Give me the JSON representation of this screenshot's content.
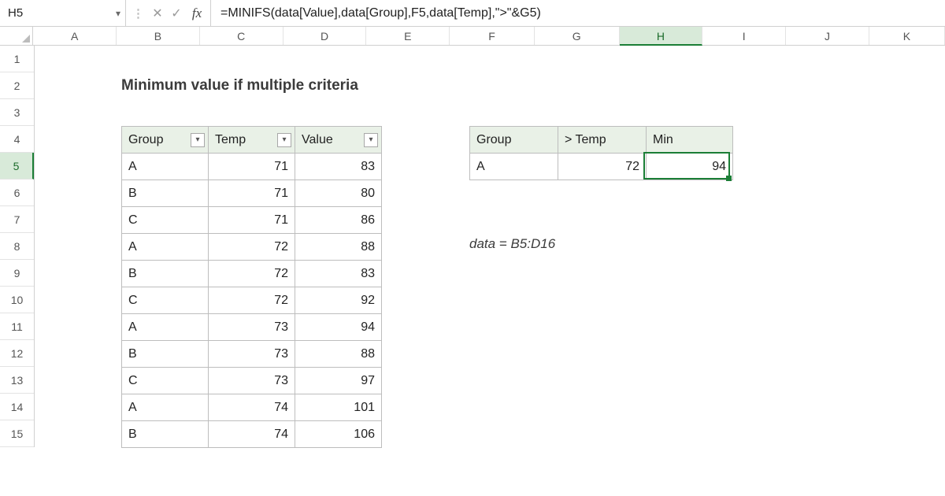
{
  "name_box": "H5",
  "formula": "=MINIFS(data[Value],data[Group],F5,data[Temp],\">\"&G5)",
  "columns": [
    "A",
    "B",
    "C",
    "D",
    "E",
    "F",
    "G",
    "H",
    "I",
    "J",
    "K"
  ],
  "row_count": 15,
  "active_col_index": 7,
  "active_row": 5,
  "title": "Minimum value if multiple criteria",
  "data_headers": [
    "Group",
    "Temp",
    "Value"
  ],
  "data_rows": [
    {
      "g": "A",
      "t": 71,
      "v": 83
    },
    {
      "g": "B",
      "t": 71,
      "v": 80
    },
    {
      "g": "C",
      "t": 71,
      "v": 86
    },
    {
      "g": "A",
      "t": 72,
      "v": 88
    },
    {
      "g": "B",
      "t": 72,
      "v": 83
    },
    {
      "g": "C",
      "t": 72,
      "v": 92
    },
    {
      "g": "A",
      "t": 73,
      "v": 94
    },
    {
      "g": "B",
      "t": 73,
      "v": 88
    },
    {
      "g": "C",
      "t": 73,
      "v": 97
    },
    {
      "g": "A",
      "t": 74,
      "v": 101
    },
    {
      "g": "B",
      "t": 74,
      "v": 106
    }
  ],
  "criteria_headers": [
    "Group",
    "> Temp",
    "Min"
  ],
  "criteria_row": {
    "group": "A",
    "temp_gt": 72,
    "min": 94
  },
  "note": "data = B5:D16"
}
